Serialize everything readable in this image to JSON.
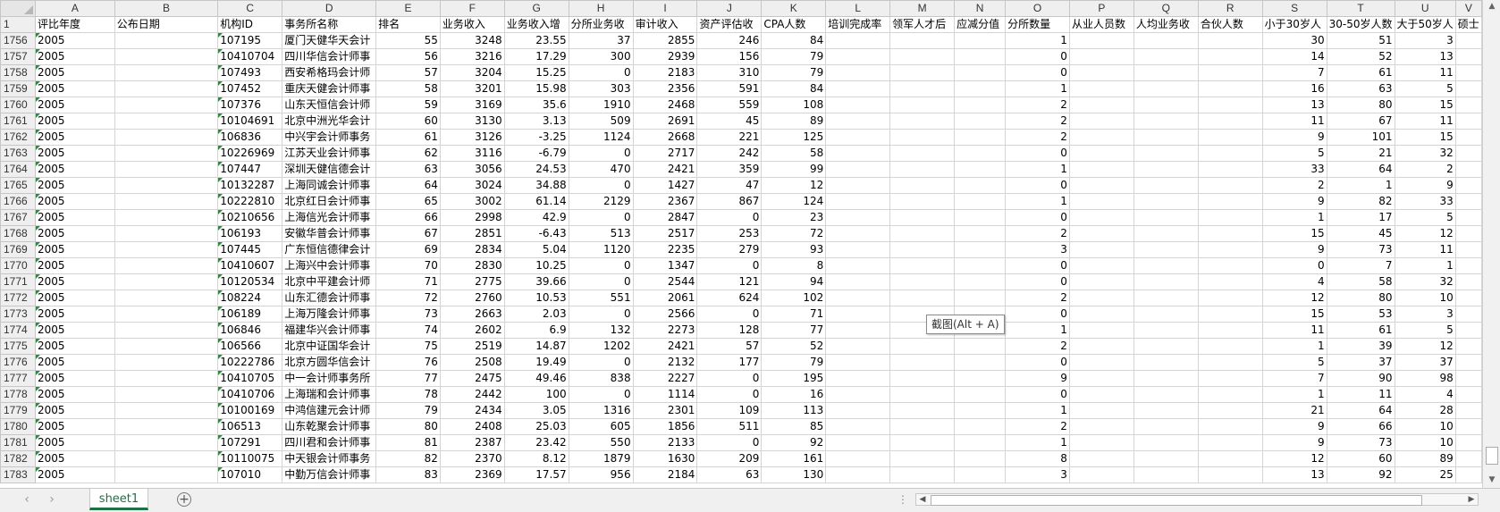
{
  "columns": [
    {
      "letter": "A",
      "header": "评比年度",
      "w": 89
    },
    {
      "letter": "B",
      "header": "公布日期",
      "w": 116
    },
    {
      "letter": "C",
      "header": "机构ID",
      "w": 72
    },
    {
      "letter": "D",
      "header": "事务所名称",
      "w": 105
    },
    {
      "letter": "E",
      "header": "排名",
      "w": 72
    },
    {
      "letter": "F",
      "header": "业务收入",
      "w": 72
    },
    {
      "letter": "G",
      "header": "业务收入增",
      "w": 72
    },
    {
      "letter": "H",
      "header": "分所业务收",
      "w": 72
    },
    {
      "letter": "I",
      "header": "审计收入",
      "w": 72
    },
    {
      "letter": "J",
      "header": "资产评估收",
      "w": 72
    },
    {
      "letter": "K",
      "header": "CPA人数",
      "w": 72
    },
    {
      "letter": "L",
      "header": "培训完成率",
      "w": 72
    },
    {
      "letter": "M",
      "header": "领军人才后",
      "w": 72
    },
    {
      "letter": "N",
      "header": "应减分值",
      "w": 57
    },
    {
      "letter": "O",
      "header": "分所数量",
      "w": 72
    },
    {
      "letter": "P",
      "header": "从业人员数",
      "w": 72
    },
    {
      "letter": "Q",
      "header": "人均业务收",
      "w": 72
    },
    {
      "letter": "R",
      "header": "合伙人数",
      "w": 72
    },
    {
      "letter": "S",
      "header": "小于30岁人",
      "w": 72
    },
    {
      "letter": "T",
      "header": "30-50岁人数",
      "w": 72
    },
    {
      "letter": "U",
      "header": "大于50岁人",
      "w": 64
    },
    {
      "letter": "V",
      "header": "硕士",
      "w": 20
    }
  ],
  "header_row_number": "1",
  "rows": [
    {
      "n": "1756",
      "c": [
        "2005",
        "",
        "107195",
        "厦门天健华天会计",
        "55",
        "3248",
        "23.55",
        "37",
        "2855",
        "246",
        "84",
        "",
        "",
        "",
        "1",
        "",
        "",
        "",
        "30",
        "51",
        "3",
        ""
      ]
    },
    {
      "n": "1757",
      "c": [
        "2005",
        "",
        "10410704",
        "四川华信会计师事",
        "56",
        "3216",
        "17.29",
        "300",
        "2939",
        "156",
        "79",
        "",
        "",
        "",
        "0",
        "",
        "",
        "",
        "14",
        "52",
        "13",
        ""
      ]
    },
    {
      "n": "1758",
      "c": [
        "2005",
        "",
        "107493",
        "西安希格玛会计师",
        "57",
        "3204",
        "15.25",
        "0",
        "2183",
        "310",
        "79",
        "",
        "",
        "",
        "0",
        "",
        "",
        "",
        "7",
        "61",
        "11",
        ""
      ]
    },
    {
      "n": "1759",
      "c": [
        "2005",
        "",
        "107452",
        "重庆天健会计师事",
        "58",
        "3201",
        "15.98",
        "303",
        "2356",
        "591",
        "84",
        "",
        "",
        "",
        "1",
        "",
        "",
        "",
        "16",
        "63",
        "5",
        ""
      ]
    },
    {
      "n": "1760",
      "c": [
        "2005",
        "",
        "107376",
        "山东天恒信会计师",
        "59",
        "3169",
        "35.6",
        "1910",
        "2468",
        "559",
        "108",
        "",
        "",
        "",
        "2",
        "",
        "",
        "",
        "13",
        "80",
        "15",
        ""
      ]
    },
    {
      "n": "1761",
      "c": [
        "2005",
        "",
        "10104691",
        "北京中洲光华会计",
        "60",
        "3130",
        "3.13",
        "509",
        "2691",
        "45",
        "89",
        "",
        "",
        "",
        "2",
        "",
        "",
        "",
        "11",
        "67",
        "11",
        ""
      ]
    },
    {
      "n": "1762",
      "c": [
        "2005",
        "",
        "106836",
        "中兴宇会计师事务",
        "61",
        "3126",
        "-3.25",
        "1124",
        "2668",
        "221",
        "125",
        "",
        "",
        "",
        "2",
        "",
        "",
        "",
        "9",
        "101",
        "15",
        ""
      ]
    },
    {
      "n": "1763",
      "c": [
        "2005",
        "",
        "10226969",
        "江苏天业会计师事",
        "62",
        "3116",
        "-6.79",
        "0",
        "2717",
        "242",
        "58",
        "",
        "",
        "",
        "0",
        "",
        "",
        "",
        "5",
        "21",
        "32",
        ""
      ]
    },
    {
      "n": "1764",
      "c": [
        "2005",
        "",
        "107447",
        "深圳天健信德会计",
        "63",
        "3056",
        "24.53",
        "470",
        "2421",
        "359",
        "99",
        "",
        "",
        "",
        "1",
        "",
        "",
        "",
        "33",
        "64",
        "2",
        ""
      ]
    },
    {
      "n": "1765",
      "c": [
        "2005",
        "",
        "10132287",
        "上海同诚会计师事",
        "64",
        "3024",
        "34.88",
        "0",
        "1427",
        "47",
        "12",
        "",
        "",
        "",
        "0",
        "",
        "",
        "",
        "2",
        "1",
        "9",
        ""
      ]
    },
    {
      "n": "1766",
      "c": [
        "2005",
        "",
        "10222810",
        "北京红日会计师事",
        "65",
        "3002",
        "61.14",
        "2129",
        "2367",
        "867",
        "124",
        "",
        "",
        "",
        "1",
        "",
        "",
        "",
        "9",
        "82",
        "33",
        ""
      ]
    },
    {
      "n": "1767",
      "c": [
        "2005",
        "",
        "10210656",
        "上海信光会计师事",
        "66",
        "2998",
        "42.9",
        "0",
        "2847",
        "0",
        "23",
        "",
        "",
        "",
        "0",
        "",
        "",
        "",
        "1",
        "17",
        "5",
        ""
      ]
    },
    {
      "n": "1768",
      "c": [
        "2005",
        "",
        "106193",
        "安徽华普会计师事",
        "67",
        "2851",
        "-6.43",
        "513",
        "2517",
        "253",
        "72",
        "",
        "",
        "",
        "2",
        "",
        "",
        "",
        "15",
        "45",
        "12",
        ""
      ]
    },
    {
      "n": "1769",
      "c": [
        "2005",
        "",
        "107445",
        "广东恒信德律会计",
        "69",
        "2834",
        "5.04",
        "1120",
        "2235",
        "279",
        "93",
        "",
        "",
        "",
        "3",
        "",
        "",
        "",
        "9",
        "73",
        "11",
        ""
      ]
    },
    {
      "n": "1770",
      "c": [
        "2005",
        "",
        "10410607",
        "上海兴中会计师事",
        "70",
        "2830",
        "10.25",
        "0",
        "1347",
        "0",
        "8",
        "",
        "",
        "",
        "0",
        "",
        "",
        "",
        "0",
        "7",
        "1",
        ""
      ]
    },
    {
      "n": "1771",
      "c": [
        "2005",
        "",
        "10120534",
        "北京中平建会计师",
        "71",
        "2775",
        "39.66",
        "0",
        "2544",
        "121",
        "94",
        "",
        "",
        "",
        "0",
        "",
        "",
        "",
        "4",
        "58",
        "32",
        ""
      ]
    },
    {
      "n": "1772",
      "c": [
        "2005",
        "",
        "108224",
        "山东汇德会计师事",
        "72",
        "2760",
        "10.53",
        "551",
        "2061",
        "624",
        "102",
        "",
        "",
        "",
        "2",
        "",
        "",
        "",
        "12",
        "80",
        "10",
        ""
      ]
    },
    {
      "n": "1773",
      "c": [
        "2005",
        "",
        "106189",
        "上海万隆会计师事",
        "73",
        "2663",
        "2.03",
        "0",
        "2566",
        "0",
        "71",
        "",
        "",
        "",
        "0",
        "",
        "",
        "",
        "15",
        "53",
        "3",
        ""
      ]
    },
    {
      "n": "1774",
      "c": [
        "2005",
        "",
        "106846",
        "福建华兴会计师事",
        "74",
        "2602",
        "6.9",
        "132",
        "2273",
        "128",
        "77",
        "",
        "",
        "",
        "1",
        "",
        "",
        "",
        "11",
        "61",
        "5",
        ""
      ]
    },
    {
      "n": "1775",
      "c": [
        "2005",
        "",
        "106566",
        "北京中证国华会计",
        "75",
        "2519",
        "14.87",
        "1202",
        "2421",
        "57",
        "52",
        "",
        "",
        "",
        "2",
        "",
        "",
        "",
        "1",
        "39",
        "12",
        ""
      ]
    },
    {
      "n": "1776",
      "c": [
        "2005",
        "",
        "10222786",
        "北京方圆华信会计",
        "76",
        "2508",
        "19.49",
        "0",
        "2132",
        "177",
        "79",
        "",
        "",
        "",
        "0",
        "",
        "",
        "",
        "5",
        "37",
        "37",
        ""
      ]
    },
    {
      "n": "1777",
      "c": [
        "2005",
        "",
        "10410705",
        "中一会计师事务所",
        "77",
        "2475",
        "49.46",
        "838",
        "2227",
        "0",
        "195",
        "",
        "",
        "",
        "9",
        "",
        "",
        "",
        "7",
        "90",
        "98",
        ""
      ]
    },
    {
      "n": "1778",
      "c": [
        "2005",
        "",
        "10410706",
        "上海瑞和会计师事",
        "78",
        "2442",
        "100",
        "0",
        "1114",
        "0",
        "16",
        "",
        "",
        "",
        "0",
        "",
        "",
        "",
        "1",
        "11",
        "4",
        ""
      ]
    },
    {
      "n": "1779",
      "c": [
        "2005",
        "",
        "10100169",
        "中鸿信建元会计师",
        "79",
        "2434",
        "3.05",
        "1316",
        "2301",
        "109",
        "113",
        "",
        "",
        "",
        "1",
        "",
        "",
        "",
        "21",
        "64",
        "28",
        ""
      ]
    },
    {
      "n": "1780",
      "c": [
        "2005",
        "",
        "106513",
        "山东乾聚会计师事",
        "80",
        "2408",
        "25.03",
        "605",
        "1856",
        "511",
        "85",
        "",
        "",
        "",
        "2",
        "",
        "",
        "",
        "9",
        "66",
        "10",
        ""
      ]
    },
    {
      "n": "1781",
      "c": [
        "2005",
        "",
        "107291",
        "四川君和会计师事",
        "81",
        "2387",
        "23.42",
        "550",
        "2133",
        "0",
        "92",
        "",
        "",
        "",
        "1",
        "",
        "",
        "",
        "9",
        "73",
        "10",
        ""
      ]
    },
    {
      "n": "1782",
      "c": [
        "2005",
        "",
        "10110075",
        "中天银会计师事务",
        "82",
        "2370",
        "8.12",
        "1879",
        "1630",
        "209",
        "161",
        "",
        "",
        "",
        "8",
        "",
        "",
        "",
        "12",
        "60",
        "89",
        ""
      ]
    },
    {
      "n": "1783",
      "c": [
        "2005",
        "",
        "107010",
        "中勤万信会计师事",
        "83",
        "2369",
        "17.57",
        "956",
        "2184",
        "63",
        "130",
        "",
        "",
        "",
        "3",
        "",
        "",
        "",
        "13",
        "92",
        "25",
        ""
      ]
    }
  ],
  "tooltip": "截图(Alt + A)",
  "sheet_tab": "sheet1",
  "add_sheet_icon": "+",
  "nav_prev": "‹",
  "nav_next": "›"
}
